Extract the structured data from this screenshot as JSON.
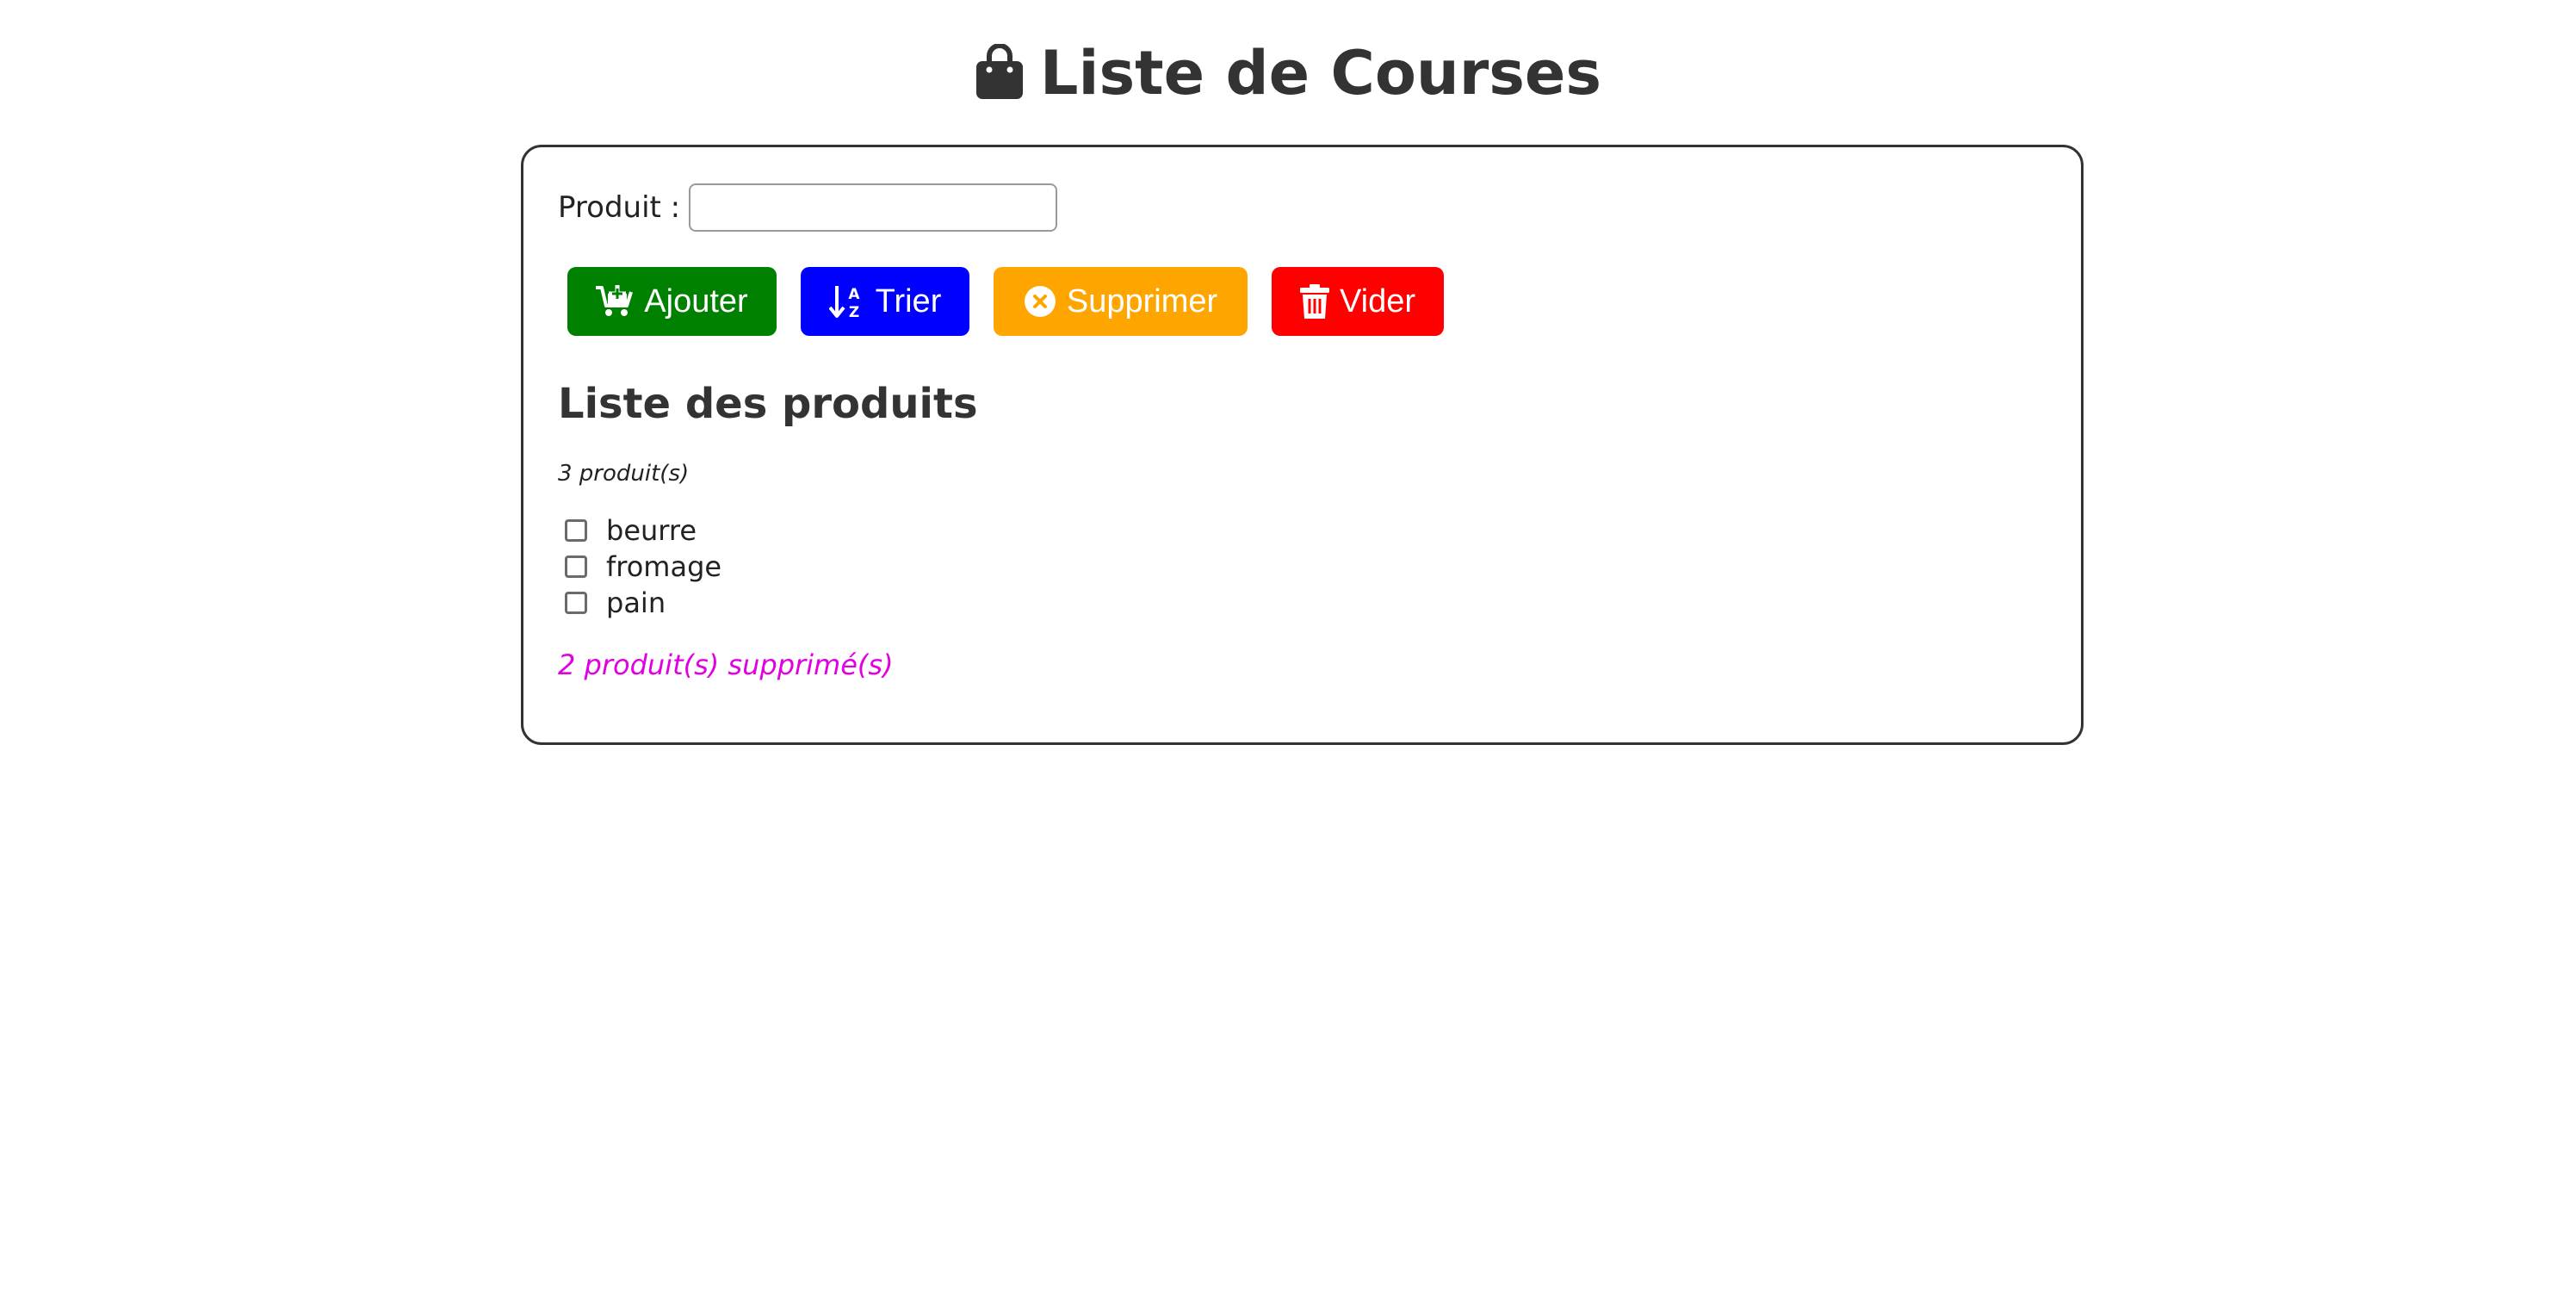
{
  "header": {
    "title": "Liste de Courses",
    "icon": "shopping-bag-icon"
  },
  "form": {
    "label": "Produit :",
    "input_value": "",
    "input_placeholder": ""
  },
  "buttons": {
    "add": {
      "label": "Ajouter",
      "icon": "cart-plus-icon",
      "color": "#008000"
    },
    "sort": {
      "label": "Trier",
      "icon": "sort-alpha-down-icon",
      "color": "#0000ff"
    },
    "remove": {
      "label": "Supprimer",
      "icon": "circle-x-icon",
      "color": "#ffa500"
    },
    "clear": {
      "label": "Vider",
      "icon": "trash-icon",
      "color": "#ff0000"
    }
  },
  "list": {
    "title": "Liste des produits",
    "count_text": "3 produit(s)",
    "items": [
      {
        "label": "beurre",
        "checked": false
      },
      {
        "label": "fromage",
        "checked": false
      },
      {
        "label": "pain",
        "checked": false
      }
    ],
    "removed_text": "2 produit(s) supprimé(s)",
    "removed_color": "#e000e0"
  }
}
